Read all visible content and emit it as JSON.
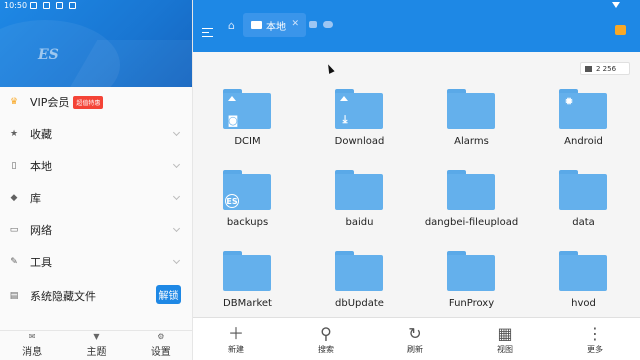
{
  "status_bar": {
    "time": "10:50"
  },
  "sidebar": {
    "logo": "ES",
    "items": [
      {
        "label": "VIP会员",
        "badge": "超值特惠",
        "icon": "crown-icon"
      },
      {
        "label": "收藏",
        "icon": "star-icon"
      },
      {
        "label": "本地",
        "icon": "phone-icon"
      },
      {
        "label": "库",
        "icon": "library-icon"
      },
      {
        "label": "网络",
        "icon": "network-icon"
      },
      {
        "label": "工具",
        "icon": "wrench-icon"
      },
      {
        "label": "系统隐藏文件",
        "icon": "hidden-file-icon",
        "button": "解锁"
      }
    ],
    "bottom_tabs": [
      {
        "label": "消息",
        "icon": "mail-icon"
      },
      {
        "label": "主题",
        "icon": "shirt-icon"
      },
      {
        "label": "设置",
        "icon": "gear-icon"
      }
    ]
  },
  "header": {
    "active_tab": "本地",
    "storage_label": "2 256"
  },
  "files": [
    {
      "name": "DCIM",
      "badge": "camera"
    },
    {
      "name": "Download",
      "badge": "download"
    },
    {
      "name": "Alarms",
      "badge": ""
    },
    {
      "name": "Android",
      "badge": "android"
    },
    {
      "name": "backups",
      "badge": "es"
    },
    {
      "name": "baidu",
      "badge": ""
    },
    {
      "name": "dangbei-fileupload",
      "badge": ""
    },
    {
      "name": "data",
      "badge": ""
    },
    {
      "name": "DBMarket",
      "badge": ""
    },
    {
      "name": "dbUpdate",
      "badge": ""
    },
    {
      "name": "FunProxy",
      "badge": ""
    },
    {
      "name": "hvod",
      "badge": ""
    }
  ],
  "toolbar": [
    {
      "label": "新建",
      "icon": "plus-icon"
    },
    {
      "label": "搜索",
      "icon": "search-icon"
    },
    {
      "label": "刷新",
      "icon": "refresh-icon"
    },
    {
      "label": "视图",
      "icon": "grid-icon"
    },
    {
      "label": "更多",
      "icon": "more-icon"
    }
  ],
  "colors": {
    "accent": "#1e88e5",
    "folder": "#64b0ec",
    "vip_badge": "#f44336"
  }
}
